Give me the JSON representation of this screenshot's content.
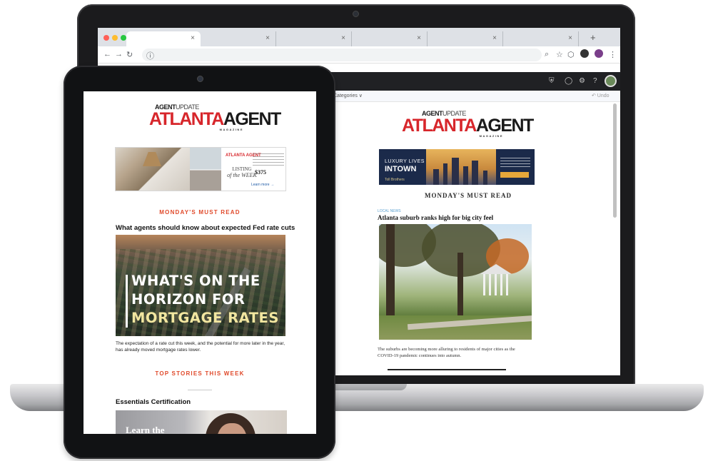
{
  "brand": {
    "top_bold": "AGENT",
    "top_light": "UPDATE",
    "main_red": "ATLANTA",
    "main_dark": "AGENT",
    "sub": "MAGAZINE"
  },
  "colors": {
    "brand_red": "#d7262b",
    "section_orange": "#e04a2b",
    "gmail_bar": "#202124",
    "device_black": "#111214"
  },
  "browser": {
    "tabs": [
      {
        "close": "×"
      },
      {
        "close": "×"
      },
      {
        "close": "×"
      },
      {
        "close": "×"
      },
      {
        "close": "×"
      },
      {
        "close": "×"
      }
    ],
    "new_tab": "+",
    "toolbar_icons": [
      "back-icon",
      "forward-icon",
      "reload-icon",
      "site-info-icon"
    ],
    "right_icons": [
      "zoom-icon",
      "star-icon",
      "extension-icon",
      "menu-icon"
    ]
  },
  "gmail": {
    "categories_label": "Categories ∨",
    "undo_label": "↶ Undo",
    "icons": [
      "shield-icon",
      "circle-icon",
      "gear-icon",
      "help-icon"
    ]
  },
  "laptop_email": {
    "ad": {
      "luxury": "LUXURY LIVES",
      "intown": "INTOWN",
      "advertiser": "Toll Brothers"
    },
    "section": "MONDAY'S MUST READ",
    "story_label": "LOCAL NEWS",
    "headline": "Atlanta suburb ranks high for big city feel",
    "caption": "The suburbs are becoming more alluring to residents of major cities as the COVID-19 pandemic continues into autumn."
  },
  "tablet_email": {
    "ad": {
      "mini_logo": "ATLANTA AGENT",
      "listing_line1": "LISTING",
      "listing_line2": "of the WEEK",
      "price": "$375",
      "learn": "Learn more →"
    },
    "section_must_read": "MONDAY'S MUST READ",
    "headline_1": "What agents should know about expected Fed rate cuts",
    "hero_lines": [
      "WHAT'S ON THE",
      "HORIZON FOR",
      "MORTGAGE RATES"
    ],
    "caption": "The expectation of a rate cut this week, and the potential for more later in the year, has already moved mortgage rates lower.",
    "section_top_stories": "TOP STORIES THIS WEEK",
    "headline_2": "Essentials Certification",
    "promo_text": "Learn the"
  }
}
